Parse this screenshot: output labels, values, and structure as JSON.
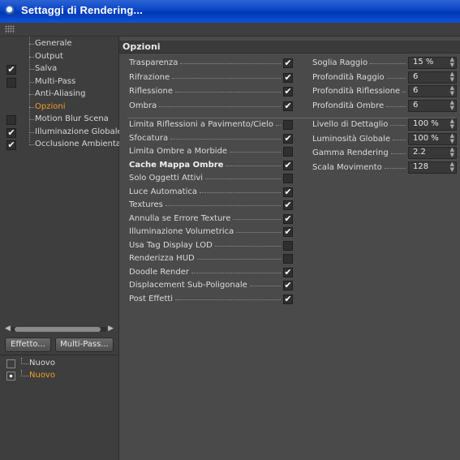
{
  "window": {
    "title": "Settaggi di Rendering..."
  },
  "sidebar": {
    "items": [
      {
        "label": "Generale",
        "checkbox": null,
        "active": false
      },
      {
        "label": "Output",
        "checkbox": null,
        "active": false
      },
      {
        "label": "Salva",
        "checkbox": true,
        "active": false
      },
      {
        "label": "Multi-Pass",
        "checkbox": false,
        "active": false
      },
      {
        "label": "Anti-Aliasing",
        "checkbox": null,
        "active": false
      },
      {
        "label": "Opzioni",
        "checkbox": null,
        "active": true
      },
      {
        "label": "Motion Blur Scena",
        "checkbox": false,
        "active": false
      },
      {
        "label": "Illuminazione Globale",
        "checkbox": true,
        "active": false
      },
      {
        "label": "Occlusione Ambientale",
        "checkbox": true,
        "active": false
      }
    ],
    "buttons": {
      "effect": "Effetto...",
      "multipass": "Multi-Pass..."
    },
    "post": [
      {
        "label": "Nuovo",
        "enabled": false,
        "active": false
      },
      {
        "label": "Nuovo",
        "enabled": true,
        "active": true
      }
    ]
  },
  "panel": {
    "title": "Opzioni",
    "left_options_top": [
      {
        "label": "Trasparenza",
        "checked": true
      },
      {
        "label": "Rifrazione",
        "checked": true
      },
      {
        "label": "Riflessione",
        "checked": true
      },
      {
        "label": "Ombra",
        "checked": true
      }
    ],
    "left_options_bottom": [
      {
        "label": "Limita Riflessioni a Pavimento/Cielo",
        "checked": false,
        "bold": false
      },
      {
        "label": "Sfocatura",
        "checked": true,
        "bold": false
      },
      {
        "label": "Limita Ombre a Morbide",
        "checked": false,
        "bold": false
      },
      {
        "label": "Cache Mappa Ombre",
        "checked": true,
        "bold": true
      },
      {
        "label": "Solo Oggetti Attivi",
        "checked": false,
        "bold": false
      },
      {
        "label": "Luce Automatica",
        "checked": true,
        "bold": false
      },
      {
        "label": "Textures",
        "checked": true,
        "bold": false
      },
      {
        "label": "Annulla se Errore Texture",
        "checked": true,
        "bold": false
      },
      {
        "label": "Illuminazione Volumetrica",
        "checked": true,
        "bold": false
      },
      {
        "label": "Usa Tag Display LOD",
        "checked": false,
        "bold": false
      },
      {
        "label": "Renderizza HUD",
        "checked": false,
        "bold": false
      },
      {
        "label": "Doodle Render",
        "checked": true,
        "bold": false
      },
      {
        "label": "Displacement Sub-Poligonale",
        "checked": true,
        "bold": false
      },
      {
        "label": "Post Effetti",
        "checked": true,
        "bold": false
      }
    ],
    "right_fields_top": [
      {
        "label": "Soglia Raggio",
        "value": "15 %"
      },
      {
        "label": "Profondità Raggio",
        "value": "6"
      },
      {
        "label": "Profondità Riflessione",
        "value": "6"
      },
      {
        "label": "Profondità Ombre",
        "value": "6"
      }
    ],
    "right_fields_bottom": [
      {
        "label": "Livello di Dettaglio",
        "value": "100 %"
      },
      {
        "label": "Luminosità Globale",
        "value": "100 %"
      },
      {
        "label": "Gamma Rendering",
        "value": "2.2"
      },
      {
        "label": "Scala Movimento",
        "value": "128"
      }
    ]
  }
}
